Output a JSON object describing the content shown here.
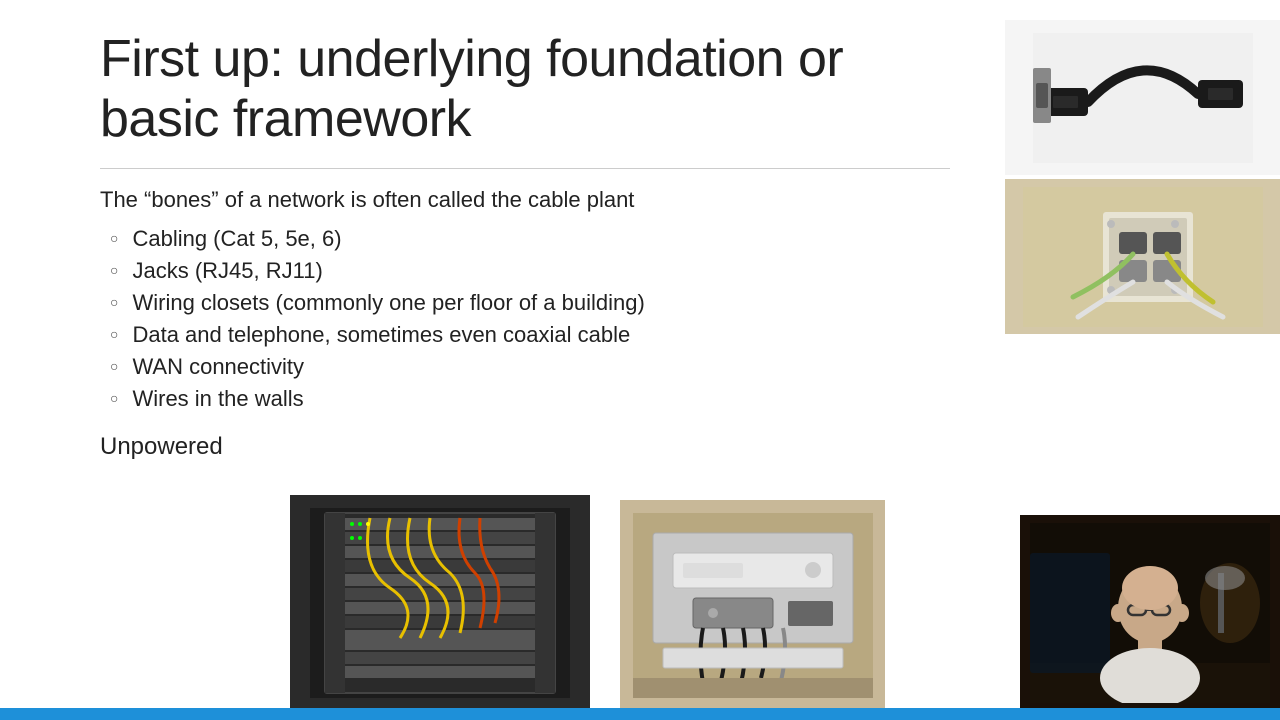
{
  "slide": {
    "title": "First up: underlying foundation or basic framework",
    "intro": "The “bones” of a network is often called the cable plant",
    "bullets": [
      "Cabling (Cat 5, 5e, 6)",
      "Jacks (RJ45, RJ11)",
      "Wiring closets (commonly one per floor of a building)",
      "Data and telephone, sometimes even coaxial cable",
      "WAN connectivity",
      "Wires in the walls"
    ],
    "section2": "Unpowered",
    "images": {
      "top_right_1_alt": "Network patch cable",
      "top_right_2_alt": "Wall jack with cables",
      "bottom_left_alt": "Server rack with cables",
      "bottom_center_alt": "Wiring closet",
      "webcam_alt": "Presenter webcam feed"
    }
  }
}
